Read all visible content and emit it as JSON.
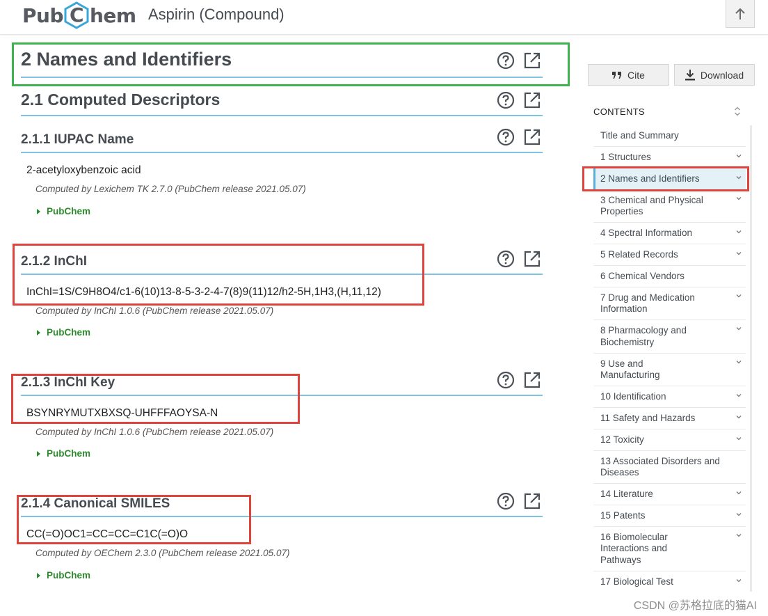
{
  "header": {
    "logo_pre": "Pub",
    "logo_c": "C",
    "logo_post": "hem",
    "page_title": "Aspirin (Compound)",
    "up_icon": "arrow-up-icon"
  },
  "main": {
    "h2": "2  Names and Identifiers",
    "h21": "2.1  Computed Descriptors",
    "sections": [
      {
        "heading": "2.1.1  IUPAC Name",
        "value": "2-acetyloxybenzoic acid",
        "computed": "Computed by Lexichem TK 2.7.0 (PubChem release 2021.05.07)",
        "source": "PubChem"
      },
      {
        "heading": "2.1.2  InChI",
        "value": "InChI=1S/C9H8O4/c1-6(10)13-8-5-3-2-4-7(8)9(11)12/h2-5H,1H3,(H,11,12)",
        "computed": "Computed by InChI 1.0.6 (PubChem release 2021.05.07)",
        "source": "PubChem"
      },
      {
        "heading": "2.1.3  InChI Key",
        "value": "BSYNRYMUTXBXSQ-UHFFFAOYSA-N",
        "computed": "Computed by InChI 1.0.6 (PubChem release 2021.05.07)",
        "source": "PubChem"
      },
      {
        "heading": "2.1.4  Canonical SMILES",
        "value": "CC(=O)OC1=CC=CC=C1C(=O)O",
        "computed": "Computed by OEChem 2.3.0 (PubChem release 2021.05.07)",
        "source": "PubChem"
      }
    ],
    "icons": [
      "help-icon",
      "popout-icon"
    ]
  },
  "sidebar": {
    "cite_label": "Cite",
    "download_label": "Download",
    "contents_label": "CONTENTS",
    "toc": [
      "Title and Summary",
      "1 Structures",
      "2 Names and Identifiers",
      "3 Chemical and Physical Properties",
      "4 Spectral Information",
      "5 Related Records",
      "6 Chemical Vendors",
      "7 Drug and Medication Information",
      "8 Pharmacology and Biochemistry",
      "9 Use and Manufacturing",
      "10 Identification",
      "11 Safety and Hazards",
      "12 Toxicity",
      "13 Associated Disorders and Diseases",
      "14 Literature",
      "15 Patents",
      "16 Biomolecular Interactions and Pathways",
      "17 Biological Test"
    ],
    "active_item": "2 Names and Identifiers"
  },
  "watermark": "CSDN @苏格拉底的猫AI",
  "colors": {
    "accent_blue": "#7ec4e2",
    "annotation_green": "#3fb350",
    "annotation_red": "#e0433c",
    "link_green": "#2c8a2c",
    "logo_hex": "#39a7d6"
  }
}
